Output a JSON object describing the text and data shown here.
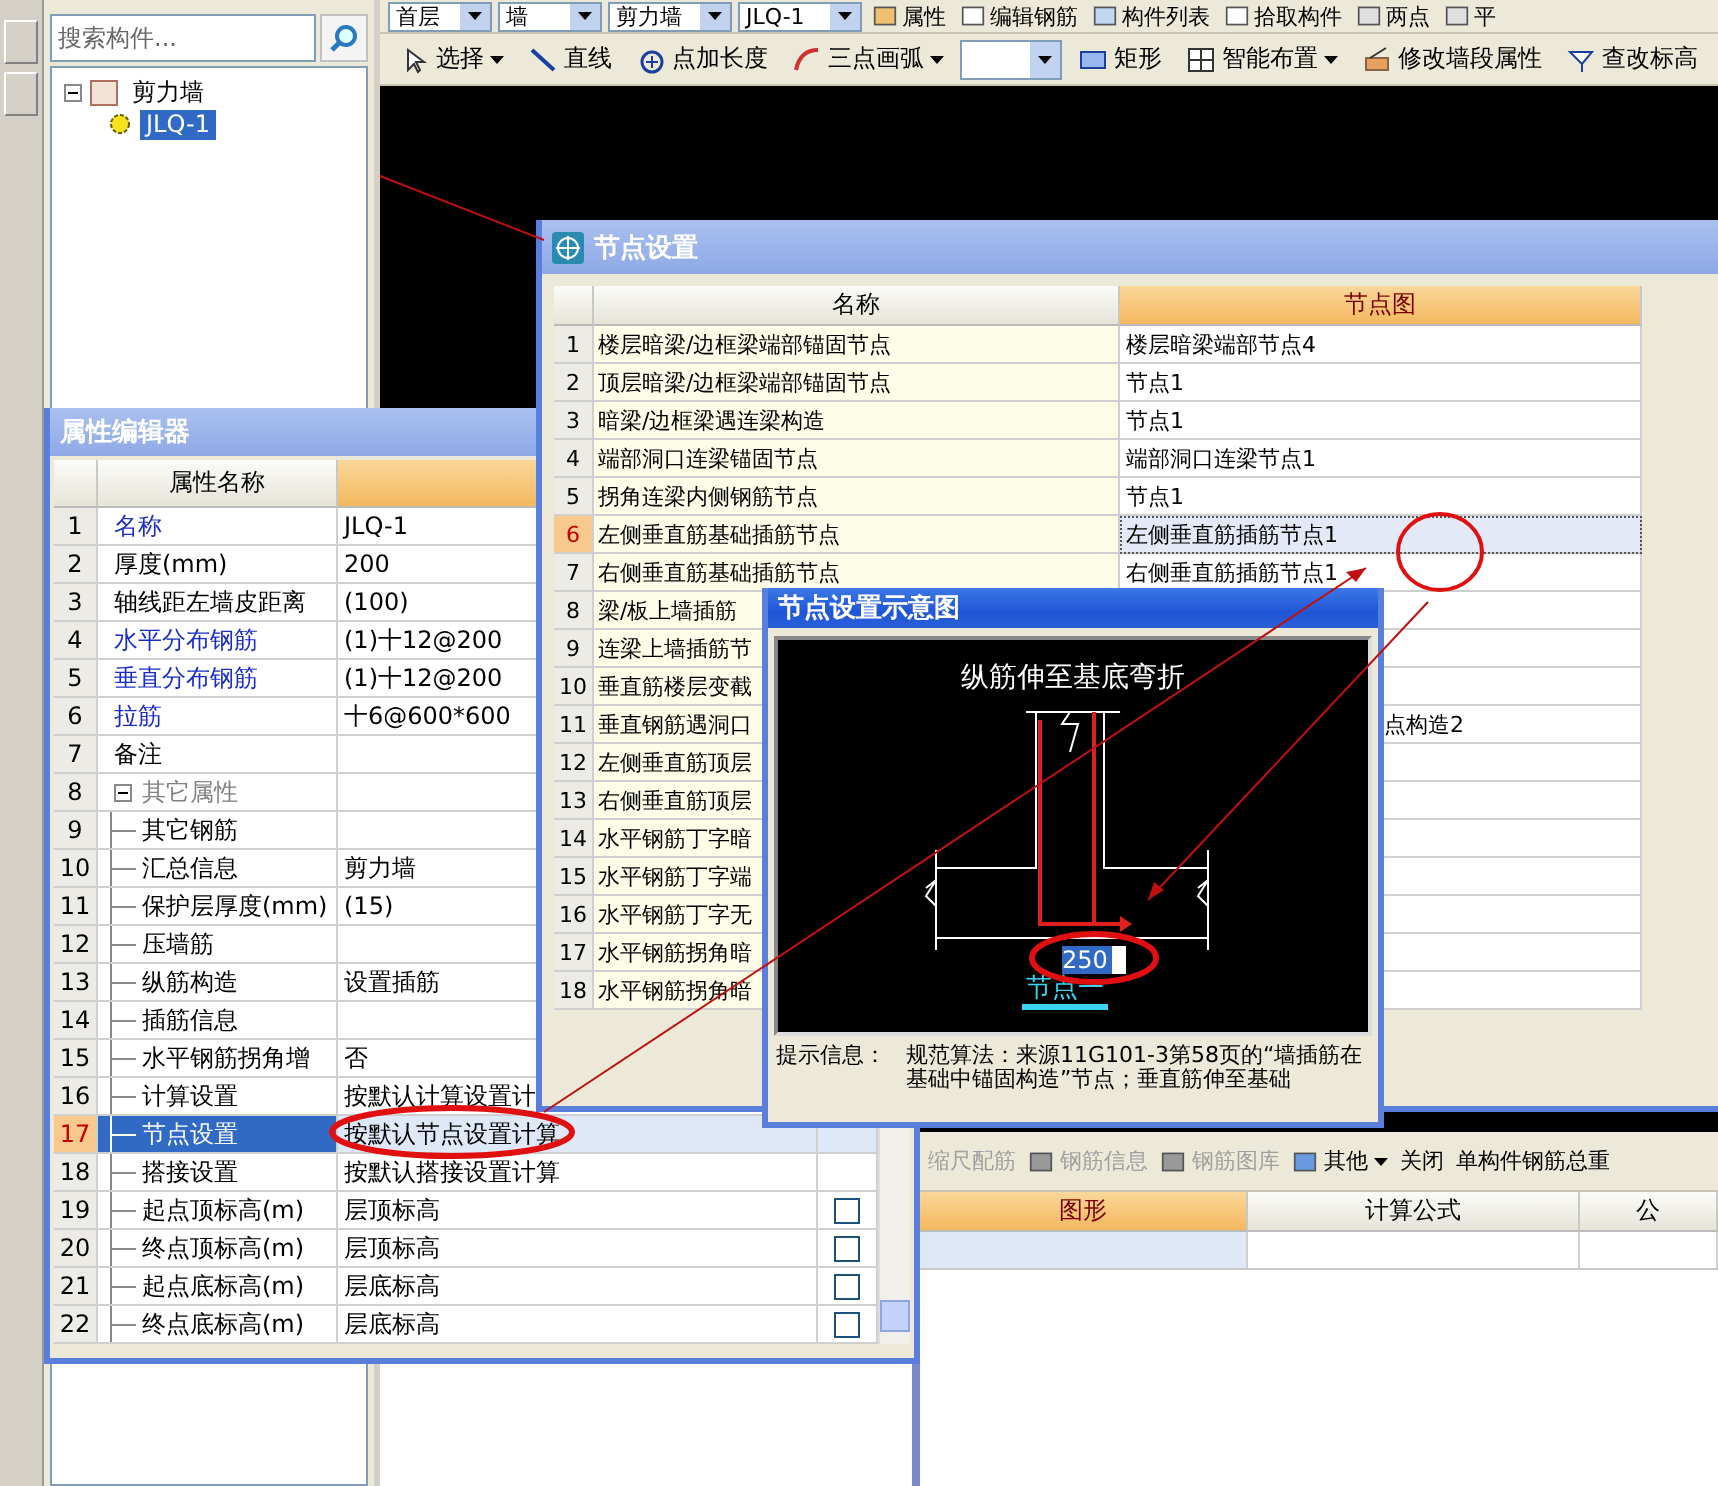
{
  "toolbar_top": {
    "dropdowns": [
      "首层",
      "墙",
      "剪力墙",
      "JLQ-1"
    ],
    "buttons": [
      "属性",
      "编辑钢筋",
      "构件列表",
      "拾取构件",
      "两点",
      "平"
    ]
  },
  "toolbar_draw": {
    "items": [
      {
        "kind": "button",
        "label": "选择",
        "caret": true
      },
      {
        "kind": "button",
        "label": "直线",
        "caret": false
      },
      {
        "kind": "button",
        "label": "点加长度",
        "caret": false
      },
      {
        "kind": "button",
        "label": "三点画弧",
        "caret": true
      },
      {
        "kind": "dropdown",
        "caret": true
      },
      {
        "kind": "button",
        "label": "矩形",
        "caret": false
      },
      {
        "kind": "button",
        "label": "智能布置",
        "caret": true
      },
      {
        "kind": "button",
        "label": "修改墙段属性",
        "caret": false
      },
      {
        "kind": "button",
        "label": "查改标高",
        "caret": false
      }
    ]
  },
  "component_tree": {
    "search": {
      "placeholder": "搜索构件..."
    },
    "items": [
      {
        "label": "剪力墙",
        "expanded": true,
        "selected": false,
        "children": [
          {
            "label": "JLQ-1",
            "selected": true
          }
        ]
      }
    ]
  },
  "property_editor": {
    "title": "属性编辑器",
    "column": "属性名称",
    "rows": [
      {
        "index": "1",
        "name": "名称",
        "value": "JLQ-1",
        "emphasized": true,
        "selected": false
      },
      {
        "index": "2",
        "name": "厚度(mm)",
        "value": "200",
        "emphasized": false,
        "selected": false
      },
      {
        "index": "3",
        "name": "轴线距左墙皮距离",
        "value": "(100)",
        "emphasized": false,
        "selected": false
      },
      {
        "index": "4",
        "name": "水平分布钢筋",
        "value": "(1)十12@200",
        "emphasized": true,
        "selected": false
      },
      {
        "index": "5",
        "name": "垂直分布钢筋",
        "value": "(1)十12@200",
        "emphasized": true,
        "selected": false
      },
      {
        "index": "6",
        "name": "拉筋",
        "value": "十6@600*600",
        "emphasized": true,
        "selected": false
      },
      {
        "index": "7",
        "name": "备注",
        "emphasized": false,
        "selected": false
      },
      {
        "index": "8",
        "name": "其它属性",
        "selected": false,
        "expanded": true,
        "children": [
          {
            "index": "9",
            "name": "其它钢筋",
            "emphasized": false,
            "selected": false
          },
          {
            "index": "10",
            "name": "汇总信息",
            "value": "剪力墙",
            "emphasized": false,
            "selected": false
          },
          {
            "index": "11",
            "name": "保护层厚度(mm)",
            "value": "(15)",
            "emphasized": false,
            "selected": false
          },
          {
            "index": "12",
            "name": "压墙筋",
            "emphasized": false,
            "selected": false
          },
          {
            "index": "13",
            "name": "纵筋构造",
            "value": "设置插筋",
            "emphasized": false,
            "selected": false
          },
          {
            "index": "14",
            "name": "插筋信息",
            "emphasized": false,
            "selected": false
          },
          {
            "index": "15",
            "name": "水平钢筋拐角增",
            "value": "否",
            "emphasized": false,
            "selected": false
          },
          {
            "index": "16",
            "name": "计算设置",
            "value": "按默认计算设置计",
            "emphasized": false,
            "selected": false
          },
          {
            "index": "17",
            "name": "节点设置",
            "value": "按默认节点设置计算",
            "emphasized": false,
            "selected": true
          },
          {
            "index": "18",
            "name": "搭接设置",
            "value": "按默认搭接设置计算",
            "emphasized": false,
            "selected": false
          },
          {
            "index": "19",
            "name": "起点顶标高(m)",
            "value": "层顶标高",
            "emphasized": false,
            "selected": false,
            "checkbox": {
              "checked": false
            }
          },
          {
            "index": "20",
            "name": "终点顶标高(m)",
            "value": "层顶标高",
            "emphasized": false,
            "selected": false,
            "checkbox": {
              "checked": false
            }
          },
          {
            "index": "21",
            "name": "起点底标高(m)",
            "value": "层底标高",
            "emphasized": false,
            "selected": false,
            "checkbox": {
              "checked": false
            }
          },
          {
            "index": "22",
            "name": "终点底标高(m)",
            "value": "层底标高",
            "emphasized": false,
            "selected": false,
            "checkbox": {
              "checked": false
            }
          }
        ]
      }
    ]
  },
  "node_settings": {
    "title": "节点设置",
    "columns": [
      {
        "label": "名称",
        "selected": false
      },
      {
        "label": "节点图",
        "selected": true
      }
    ],
    "rows": [
      {
        "index": "1",
        "name": "楼层暗梁/边框梁端部锚固节点",
        "value": "楼层暗梁端部节点4",
        "selected": false
      },
      {
        "index": "2",
        "name": "顶层暗梁/边框梁端部锚固节点",
        "value": "节点1",
        "selected": false
      },
      {
        "index": "3",
        "name": "暗梁/边框梁遇连梁构造",
        "value": "节点1",
        "selected": false
      },
      {
        "index": "4",
        "name": "端部洞口连梁锚固节点",
        "value": "端部洞口连梁节点1",
        "selected": false
      },
      {
        "index": "5",
        "name": "拐角连梁内侧钢筋节点",
        "value": "节点1",
        "selected": false
      },
      {
        "index": "6",
        "name": "左侧垂直筋基础插筋节点",
        "value": "左侧垂直筋插筋节点1",
        "selected": true
      },
      {
        "index": "7",
        "name": "右侧垂直筋基础插筋节点",
        "value": "右侧垂直筋插筋节点1",
        "selected": false
      },
      {
        "index": "8",
        "name": "梁/板上墙插筋",
        "selected": false
      },
      {
        "index": "9",
        "name": "连梁上墙插筋节",
        "selected": false
      },
      {
        "index": "10",
        "name": "垂直筋楼层变截",
        "selected": false
      },
      {
        "index": "11",
        "name": "垂直钢筋遇洞口",
        "value": "点构造2",
        "selected": false,
        "covered": true
      },
      {
        "index": "12",
        "name": "左侧垂直筋顶层",
        "selected": false
      },
      {
        "index": "13",
        "name": "右侧垂直筋顶层",
        "selected": false
      },
      {
        "index": "14",
        "name": "水平钢筋丁字暗",
        "selected": false
      },
      {
        "index": "15",
        "name": "水平钢筋丁字端",
        "selected": false
      },
      {
        "index": "16",
        "name": "水平钢筋丁字无",
        "selected": false
      },
      {
        "index": "17",
        "name": "水平钢筋拐角暗",
        "selected": false
      },
      {
        "index": "18",
        "name": "水平钢筋拐角暗",
        "selected": false
      }
    ]
  },
  "node_diagram": {
    "title": "节点设置示意图",
    "caption": "纵筋伸至基底弯折",
    "dimension": "250",
    "node_label": "节点一",
    "tip_label": "提示信息：",
    "tip_text": "规范算法：来源11G101-3第58页的“墙插筋在基础中锚固构造”节点；垂直筋伸至基础"
  },
  "rebar_panel": {
    "toolbar": [
      {
        "label": "缩尺配筋",
        "disabled": true,
        "icon": false,
        "caret": false
      },
      {
        "label": "钢筋信息",
        "disabled": true,
        "icon": true,
        "caret": false
      },
      {
        "label": "钢筋图库",
        "disabled": true,
        "icon": true,
        "caret": false
      },
      {
        "label": "其他",
        "disabled": false,
        "icon": true,
        "caret": true
      },
      {
        "label": "关闭",
        "disabled": false,
        "icon": false,
        "caret": false
      },
      {
        "label": "单构件钢筋总重",
        "disabled": false,
        "icon": false,
        "caret": false
      }
    ],
    "columns": [
      {
        "label": "图形",
        "selected": true
      },
      {
        "label": "计算公式",
        "selected": false
      },
      {
        "label": "公",
        "selected": false
      }
    ]
  }
}
